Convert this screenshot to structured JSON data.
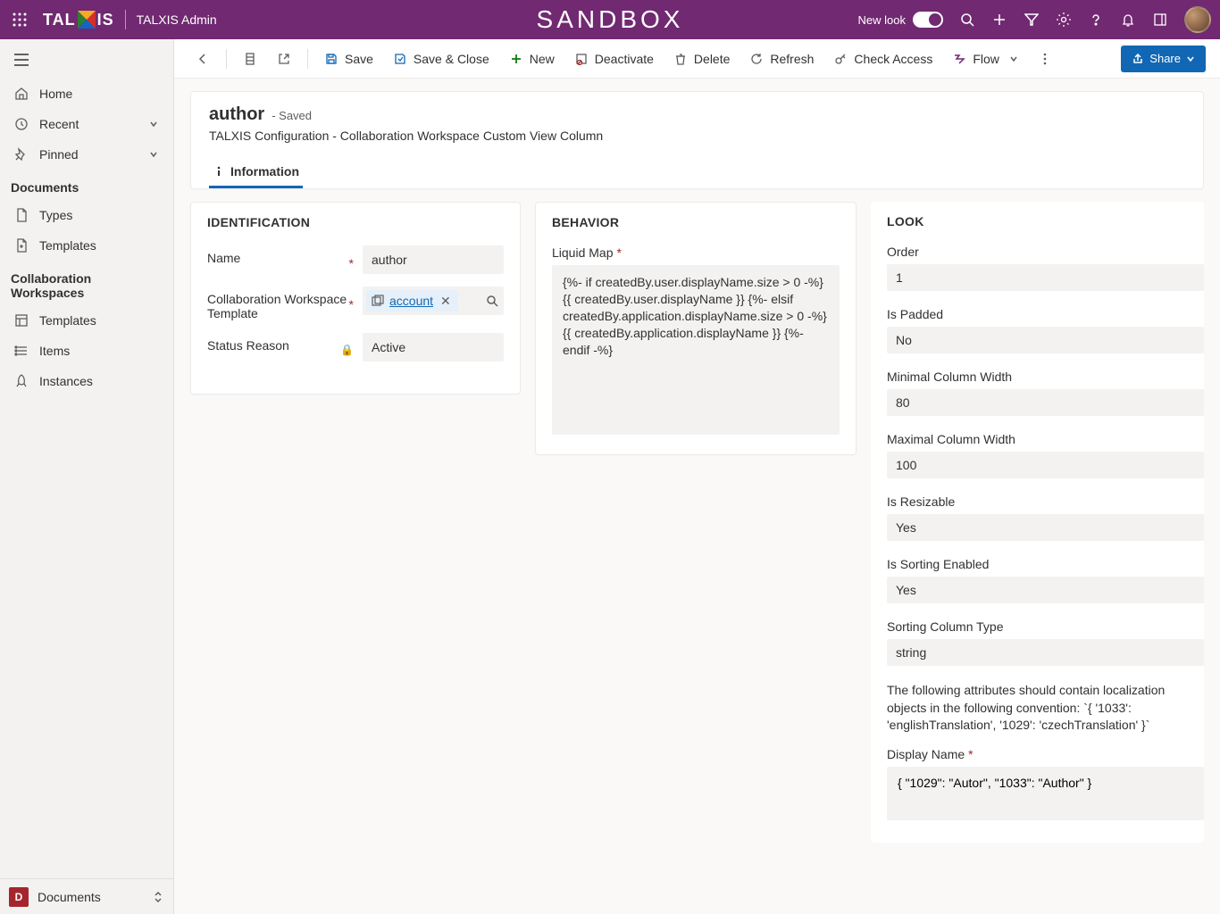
{
  "topbar": {
    "app_name": "TALXIS Admin",
    "env_banner": "SANDBOX",
    "new_look_label": "New look"
  },
  "sidebar": {
    "home": "Home",
    "recent": "Recent",
    "pinned": "Pinned",
    "group_documents": "Documents",
    "types": "Types",
    "templates": "Templates",
    "group_collab": "Collaboration Workspaces",
    "cw_templates": "Templates",
    "cw_items": "Items",
    "cw_instances": "Instances",
    "area_badge": "D",
    "area_label": "Documents"
  },
  "cmdbar": {
    "save": "Save",
    "save_close": "Save & Close",
    "new": "New",
    "deactivate": "Deactivate",
    "delete": "Delete",
    "refresh": "Refresh",
    "check_access": "Check Access",
    "flow": "Flow",
    "share": "Share"
  },
  "header": {
    "title": "author",
    "saved": "- Saved",
    "subtitle": "TALXIS Configuration - Collaboration Workspace Custom View Column",
    "tab_info": "Information"
  },
  "identification": {
    "section": "IDENTIFICATION",
    "name_label": "Name",
    "name_value": "author",
    "cwt_label": "Collaboration Workspace Template",
    "cwt_value": "account",
    "status_label": "Status Reason",
    "status_value": "Active"
  },
  "behavior": {
    "section": "BEHAVIOR",
    "liquid_label": "Liquid Map",
    "liquid_value": "        {%- if createdBy.user.displayName.size > 0 -%}        {{ createdBy.user.displayName }}        {%- elsif createdBy.application.displayName.size > 0 -%}        {{ createdBy.application.displayName }}        {%- endif -%}"
  },
  "look": {
    "section": "LOOK",
    "order_label": "Order",
    "order_value": "1",
    "padded_label": "Is Padded",
    "padded_value": "No",
    "minw_label": "Minimal Column Width",
    "minw_value": "80",
    "maxw_label": "Maximal Column Width",
    "maxw_value": "100",
    "resizable_label": "Is Resizable",
    "resizable_value": "Yes",
    "sorting_label": "Is Sorting Enabled",
    "sorting_value": "Yes",
    "sorttype_label": "Sorting Column Type",
    "sorttype_value": "string",
    "note": "The following attributes should contain localization objects in the following convention: `{ '1033': 'englishTranslation', '1029': 'czechTranslation' }`",
    "display_label": "Display Name",
    "display_value": "{ \"1029\": \"Autor\", \"1033\": \"Author\" }"
  }
}
